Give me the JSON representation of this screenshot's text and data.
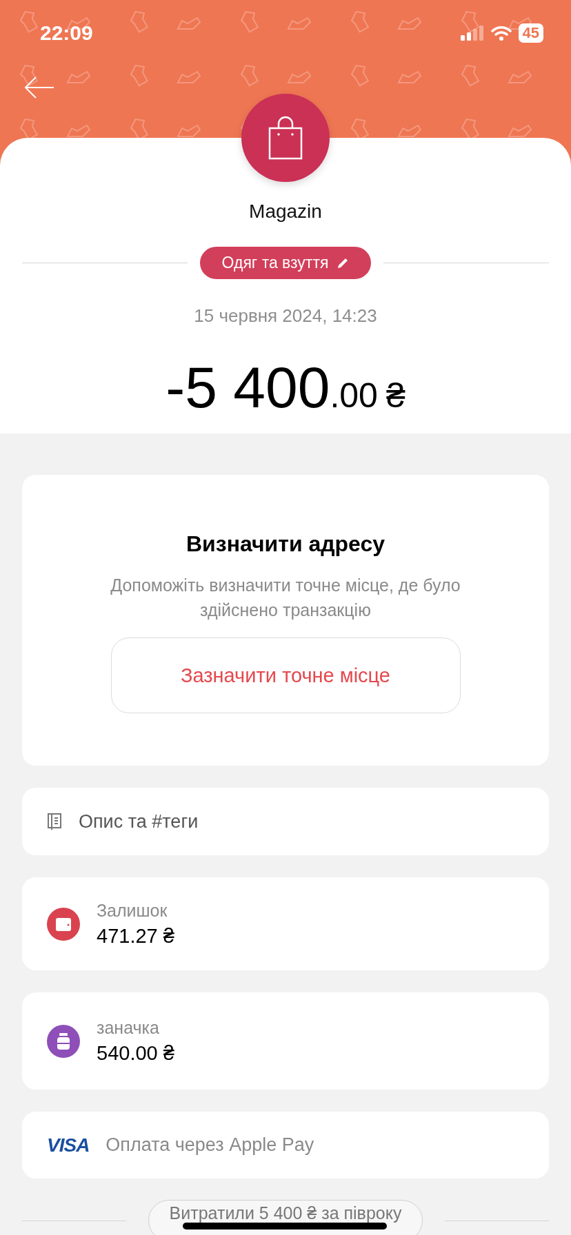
{
  "status_bar": {
    "time": "22:09",
    "battery": "45"
  },
  "merchant": {
    "name": "Magazin"
  },
  "category": {
    "label": "Одяг та взуття"
  },
  "date": "15 червня 2024, 14:23",
  "amount": {
    "main": "-5 400",
    "fraction": ".00",
    "currency": "₴"
  },
  "location_card": {
    "title": "Визначити адресу",
    "description": "Допоможіть визначити точне місце, де було здійснено транзакцію",
    "button": "Зазначити точне місце"
  },
  "note": {
    "label": "Опис та #теги"
  },
  "accounts": [
    {
      "kind": "wallet",
      "color": "#d9434f",
      "label": "Залишок",
      "amount": "471.27 ₴"
    },
    {
      "kind": "jar",
      "color": "#8e4fb8",
      "label": "заначка",
      "amount": "540.00 ₴"
    }
  ],
  "payment": {
    "card_brand": "VISA",
    "method": "Оплата через Apple Pay"
  },
  "summary": {
    "label": "Витратили 5 400 ₴ за півроку"
  }
}
